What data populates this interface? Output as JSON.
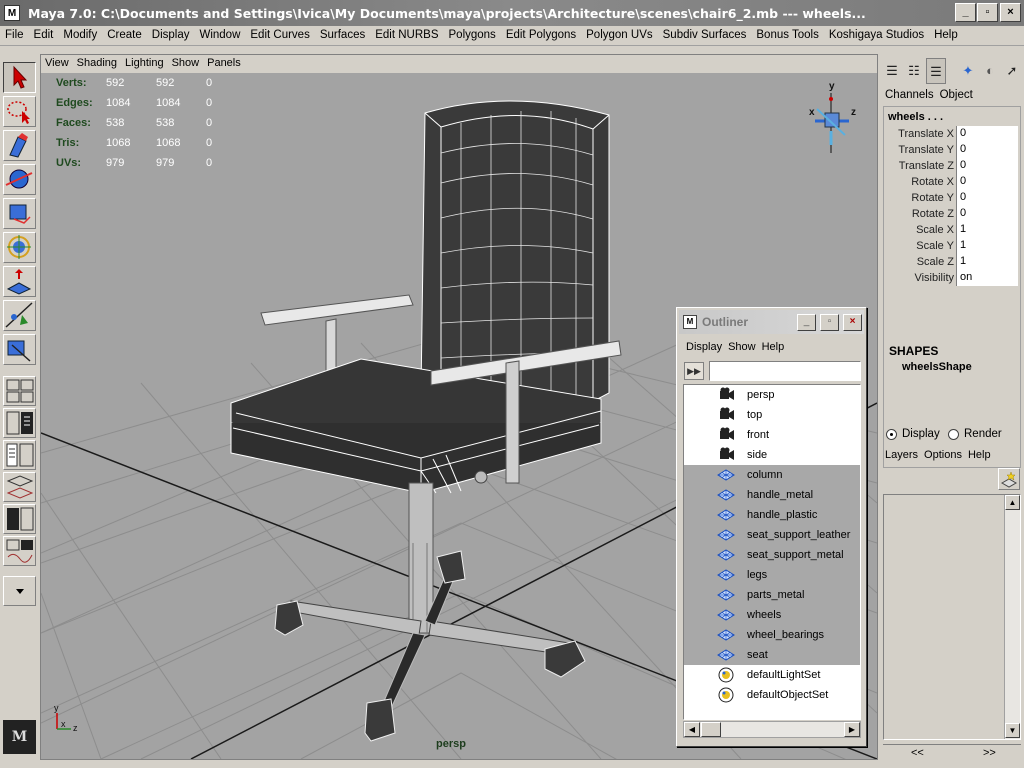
{
  "window": {
    "app_icon": "M",
    "title": "Maya 7.0: C:\\Documents and Settings\\Ivica\\My Documents\\maya\\projects\\Architecture\\scenes\\chair6_2.mb   ---   wheels...",
    "minimize": "_",
    "maximize": "▫",
    "close": "×"
  },
  "main_menu": [
    "File",
    "Edit",
    "Modify",
    "Create",
    "Display",
    "Window",
    "Edit Curves",
    "Surfaces",
    "Edit NURBS",
    "Polygons",
    "Edit Polygons",
    "Polygon UVs",
    "Subdiv Surfaces",
    "Bonus Tools",
    "Koshigaya Studios",
    "Help"
  ],
  "viewport": {
    "menu": [
      "View",
      "Shading",
      "Lighting",
      "Show",
      "Panels"
    ],
    "camera": "persp",
    "axis_labels": {
      "y": "y",
      "x": "x",
      "z": "z"
    },
    "hud": [
      {
        "label": "Verts:",
        "v1": "592",
        "v2": "592",
        "v3": "0"
      },
      {
        "label": "Edges:",
        "v1": "1084",
        "v2": "1084",
        "v3": "0"
      },
      {
        "label": "Faces:",
        "v1": "538",
        "v2": "538",
        "v3": "0"
      },
      {
        "label": "Tris:",
        "v1": "1068",
        "v2": "1068",
        "v3": "0"
      },
      {
        "label": "UVs:",
        "v1": "979",
        "v2": "979",
        "v3": "0"
      }
    ],
    "bg_color": "#a3a3a3",
    "wire_color": "#ffffff",
    "mesh_color": "#3a3a3a"
  },
  "toolbox": {
    "logo": "M",
    "tools": [
      "select-tool",
      "lasso-tool",
      "paint-select-tool",
      "move-tool",
      "rotate-tool",
      "scale-tool",
      "manipulator-tool",
      "soft-mod-tool",
      "show-manipulator-tool",
      "last-used-tool"
    ]
  },
  "outliner": {
    "title": "Outliner",
    "menu": [
      "Display",
      "Show",
      "Help"
    ],
    "filter_value": "",
    "items": [
      {
        "name": "persp",
        "icon": "camera",
        "selected": false
      },
      {
        "name": "top",
        "icon": "camera",
        "selected": false
      },
      {
        "name": "front",
        "icon": "camera",
        "selected": false
      },
      {
        "name": "side",
        "icon": "camera",
        "selected": false
      },
      {
        "name": "column",
        "icon": "mesh",
        "selected": true
      },
      {
        "name": "handle_metal",
        "icon": "mesh",
        "selected": true
      },
      {
        "name": "handle_plastic",
        "icon": "mesh",
        "selected": true
      },
      {
        "name": "seat_support_leather",
        "icon": "mesh",
        "selected": true
      },
      {
        "name": "seat_support_metal",
        "icon": "mesh",
        "selected": true
      },
      {
        "name": "legs",
        "icon": "mesh",
        "selected": true
      },
      {
        "name": "parts_metal",
        "icon": "mesh",
        "selected": true
      },
      {
        "name": "wheels",
        "icon": "mesh",
        "selected": true
      },
      {
        "name": "wheel_bearings",
        "icon": "mesh",
        "selected": true
      },
      {
        "name": "seat",
        "icon": "mesh",
        "selected": true
      },
      {
        "name": "defaultLightSet",
        "icon": "set",
        "selected": false
      },
      {
        "name": "defaultObjectSet",
        "icon": "set",
        "selected": false
      }
    ]
  },
  "channel_box": {
    "menu": [
      "Channels",
      "Object"
    ],
    "object_name": "wheels . . .",
    "attributes": [
      {
        "label": "Translate X",
        "value": "0"
      },
      {
        "label": "Translate Y",
        "value": "0"
      },
      {
        "label": "Translate Z",
        "value": "0"
      },
      {
        "label": "Rotate X",
        "value": "0"
      },
      {
        "label": "Rotate Y",
        "value": "0"
      },
      {
        "label": "Rotate Z",
        "value": "0"
      },
      {
        "label": "Scale X",
        "value": "1"
      },
      {
        "label": "Scale Y",
        "value": "1"
      },
      {
        "label": "Scale Z",
        "value": "1"
      },
      {
        "label": "Visibility",
        "value": "on"
      }
    ],
    "shapes_title": "SHAPES",
    "shape_name": "wheelsShape"
  },
  "layer_editor": {
    "display_label": "Display",
    "render_label": "Render",
    "display_selected": true,
    "menu": [
      "Layers",
      "Options",
      "Help"
    ],
    "prev": "<<",
    "next": ">>"
  }
}
